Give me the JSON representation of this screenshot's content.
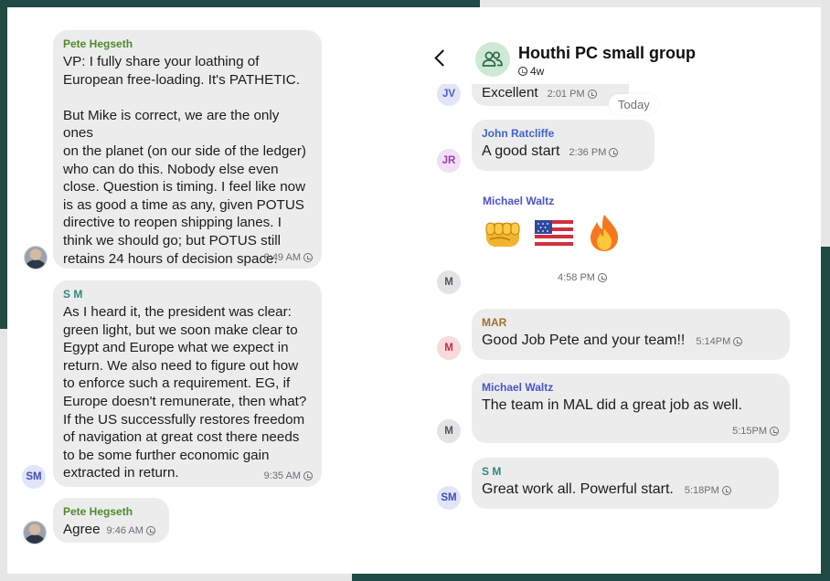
{
  "left_panel": {
    "messages": [
      {
        "sender": "Pete Hegseth",
        "text": "VP: I fully share your loathing of\nEuropean free-loading. It's PATHETIC.\n\nBut Mike is correct, we are the only ones\non the planet (on our side of the ledger)\nwho can do this. Nobody else even\nclose. Question is timing. I feel like now\nis as good a time as any, given POTUS\ndirective to reopen shipping lanes. I\nthink we should go; but POTUS still\nretains 24 hours of decision space.",
        "time": "8:49 AM"
      },
      {
        "sender": "S M",
        "avatar": "SM",
        "text": "As I heard it, the president was clear:\ngreen light, but we soon make clear to\nEgypt and Europe what we expect in\nreturn. We also need to figure out how\nto enforce such a requirement. EG, if\nEurope doesn't remunerate, then what?\nIf the US successfully restores freedom\nof navigation at great cost there needs\nto be some further economic gain\nextracted in return.",
        "time": "9:35 AM"
      },
      {
        "sender": "Pete Hegseth",
        "text": "Agree",
        "time": "9:46 AM"
      }
    ]
  },
  "right_panel": {
    "header": {
      "title": "Houthi PC small group",
      "subtitle": "4w"
    },
    "today_label": "Today",
    "messages": [
      {
        "avatar": "JV",
        "text": "Excellent",
        "time": "2:01 PM"
      },
      {
        "sender": "John Ratcliffe",
        "avatar": "JR",
        "text": "A good start",
        "time": "2:36 PM"
      },
      {
        "sender": "Michael Waltz",
        "avatar": "M",
        "emojis": [
          "oncoming-fist",
          "us-flag",
          "fire"
        ],
        "time": "4:58 PM"
      },
      {
        "sender": "MAR",
        "avatar": "M",
        "text": "Good Job Pete and your team!!",
        "time": "5:14PM"
      },
      {
        "sender": "Michael Waltz",
        "avatar": "M",
        "text": "The team in MAL did a great job  as well.",
        "time": "5:15PM"
      },
      {
        "sender": "S M",
        "avatar": "SM",
        "text": "Great work all. Powerful start.",
        "time": "5:18PM"
      }
    ]
  },
  "colors": {
    "pete_name": "#4e8a2b",
    "sm_name": "#2f8a78",
    "jr_name": "#3e63c9",
    "mw_name": "#4a55c4",
    "mar_name": "#a0702b",
    "bubble": "#ececed",
    "frame_green": "#1f4b44"
  }
}
